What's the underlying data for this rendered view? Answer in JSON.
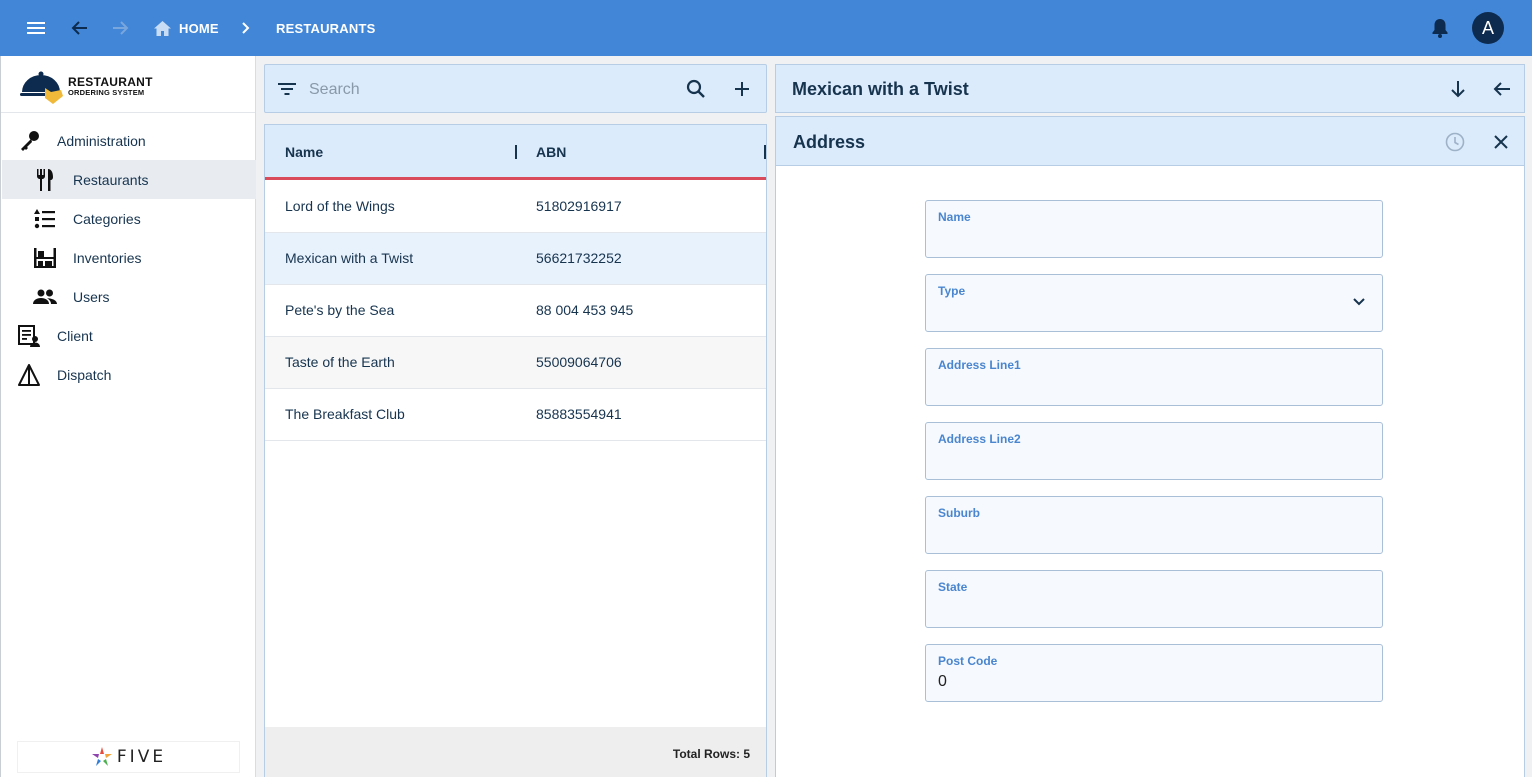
{
  "topbar": {
    "icons": [
      "menu-icon",
      "back-arrow-icon",
      "forward-arrow-icon",
      "home-icon",
      "chevron-right-icon",
      "bell-icon"
    ],
    "breadcrumb_home": "HOME",
    "breadcrumb_current": "RESTAURANTS",
    "avatar_letter": "A",
    "color": "#4286d8"
  },
  "sidebar": {
    "logo_line1": "RESTAURANT",
    "logo_line2": "ORDERING SYSTEM",
    "items": [
      {
        "label": "Administration",
        "icon": "key-icon"
      },
      {
        "label": "Restaurants",
        "icon": "fork-knife-icon",
        "selected": true
      },
      {
        "label": "Categories",
        "icon": "list-icon"
      },
      {
        "label": "Inventories",
        "icon": "shelves-icon"
      },
      {
        "label": "Users",
        "icon": "users-icon"
      },
      {
        "label": "Client",
        "icon": "client-form-icon"
      },
      {
        "label": "Dispatch",
        "icon": "dispatch-icon"
      }
    ],
    "footer_logo": "FIVE"
  },
  "list": {
    "search_placeholder": "Search",
    "columns": [
      "Name",
      "ABN"
    ],
    "rows": [
      {
        "name": "Lord of the Wings",
        "abn": "51802916917"
      },
      {
        "name": "Mexican with a Twist",
        "abn": "56621732252",
        "selected": true
      },
      {
        "name": "Pete's by the Sea",
        "abn": "88 004 453 945"
      },
      {
        "name": "Taste of the Earth",
        "abn": "55009064706"
      },
      {
        "name": "The Breakfast Club",
        "abn": "85883554941"
      }
    ],
    "total_rows": "Total Rows: 5",
    "accent": "#d94a5a"
  },
  "detail": {
    "title": "Mexican with a Twist",
    "form_title": "Address",
    "fields": [
      {
        "label": "Name",
        "value": ""
      },
      {
        "label": "Type",
        "value": "",
        "dropdown": true
      },
      {
        "label": "Address Line1",
        "value": ""
      },
      {
        "label": "Address Line2",
        "value": ""
      },
      {
        "label": "Suburb",
        "value": ""
      },
      {
        "label": "State",
        "value": ""
      },
      {
        "label": "Post Code",
        "value": "0"
      }
    ]
  }
}
